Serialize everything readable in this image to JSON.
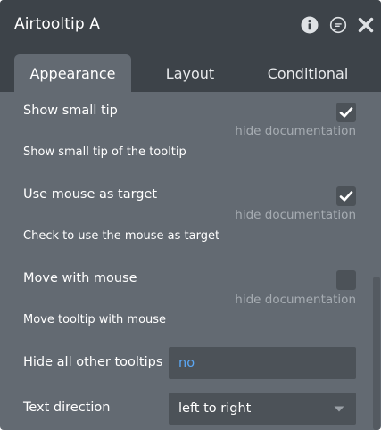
{
  "panel": {
    "title": "Airtooltip A",
    "icons": [
      "info-icon",
      "comment-icon",
      "close-icon"
    ]
  },
  "tabs": [
    {
      "label": "Appearance",
      "active": true
    },
    {
      "label": "Layout",
      "active": false
    },
    {
      "label": "Conditional",
      "active": false
    }
  ],
  "settings": {
    "small_tip": {
      "label": "Show small tip",
      "checked": true,
      "hide_doc": "hide documentation",
      "doc": "Show small tip of the tooltip"
    },
    "mouse_target": {
      "label": "Use mouse as target",
      "checked": true,
      "hide_doc": "hide documentation",
      "doc": "Check to use the mouse as target"
    },
    "move_mouse": {
      "label": "Move with mouse",
      "checked": false,
      "hide_doc": "hide documentation",
      "doc": "Move tooltip with mouse"
    },
    "hide_others": {
      "label": "Hide all other tooltips",
      "value": "no"
    },
    "text_direction": {
      "label": "Text direction",
      "value": "left to right"
    }
  },
  "colors": {
    "panel_bg": "#636a72",
    "header_bg": "#3d4349",
    "field_bg": "#4c5258",
    "link_blue": "#5ba8f5",
    "muted_text": "#a6acb2"
  }
}
